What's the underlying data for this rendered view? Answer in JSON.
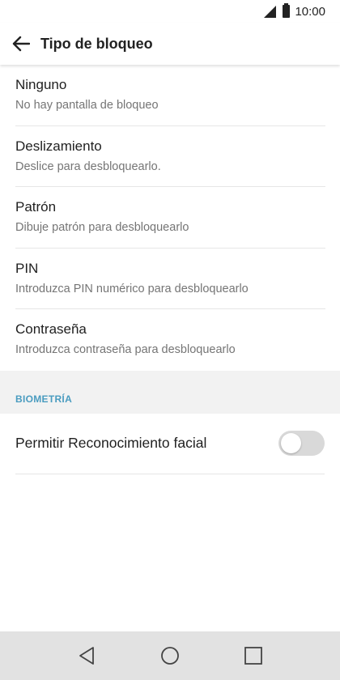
{
  "status_bar": {
    "time": "10:00"
  },
  "app_bar": {
    "title": "Tipo de bloqueo"
  },
  "lock_options": [
    {
      "title": "Ninguno",
      "subtitle": "No hay pantalla de bloqueo"
    },
    {
      "title": "Deslizamiento",
      "subtitle": "Deslice para desbloquearlo."
    },
    {
      "title": "Patrón",
      "subtitle": "Dibuje patrón para desbloquearlo"
    },
    {
      "title": "PIN",
      "subtitle": "Introduzca PIN numérico para desbloquearlo"
    },
    {
      "title": "Contraseña",
      "subtitle": "Introduzca contraseña para desbloquearlo"
    }
  ],
  "biometrics": {
    "header": "BIOMETRÍA",
    "face_unlock_label": "Permitir Reconocimiento facial",
    "face_unlock_enabled": false
  },
  "colors": {
    "section_header": "#4a9cc0",
    "toggle_off": "#d9d9d9"
  },
  "icons": {
    "back": "arrow-left-icon",
    "nav_back": "triangle-back-icon",
    "nav_home": "circle-home-icon",
    "nav_recents": "square-recents-icon"
  }
}
